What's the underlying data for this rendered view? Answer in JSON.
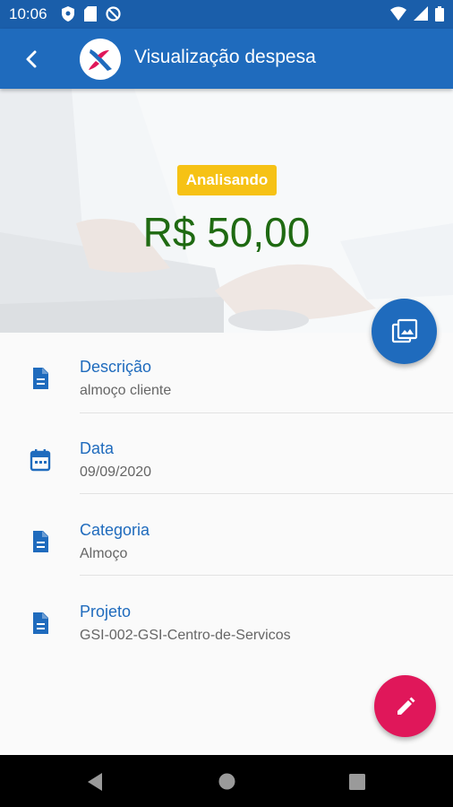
{
  "status_bar": {
    "time": "10:06",
    "left_icons": [
      "shield-icon",
      "sd-card-icon",
      "no-disturb-icon"
    ],
    "right_icons": [
      "wifi-icon",
      "cellular-icon",
      "battery-icon"
    ]
  },
  "app_bar": {
    "title": "Visualização despesa",
    "back_icon": "arrow-back-icon",
    "logo": "app-logo"
  },
  "header": {
    "status_badge": "Analisando",
    "amount": "R$ 50,00",
    "gallery_icon": "photo-library-icon"
  },
  "details": [
    {
      "label": "Descrição",
      "value": "almoço cliente",
      "icon": "document-icon"
    },
    {
      "label": "Data",
      "value": "09/09/2020",
      "icon": "calendar-icon"
    },
    {
      "label": "Categoria",
      "value": "Almoço",
      "icon": "document-icon"
    },
    {
      "label": "Projeto",
      "value": "GSI-002-GSI-Centro-de-Servicos",
      "icon": "document-icon"
    }
  ],
  "edit_fab": {
    "icon": "pencil-icon"
  },
  "colors": {
    "primary": "#1f6bbd",
    "status_bar": "#1a5eaa",
    "badge": "#f6c215",
    "amount": "#1f6a12",
    "edit_fab": "#e0175a",
    "label": "#1f6bbd"
  }
}
